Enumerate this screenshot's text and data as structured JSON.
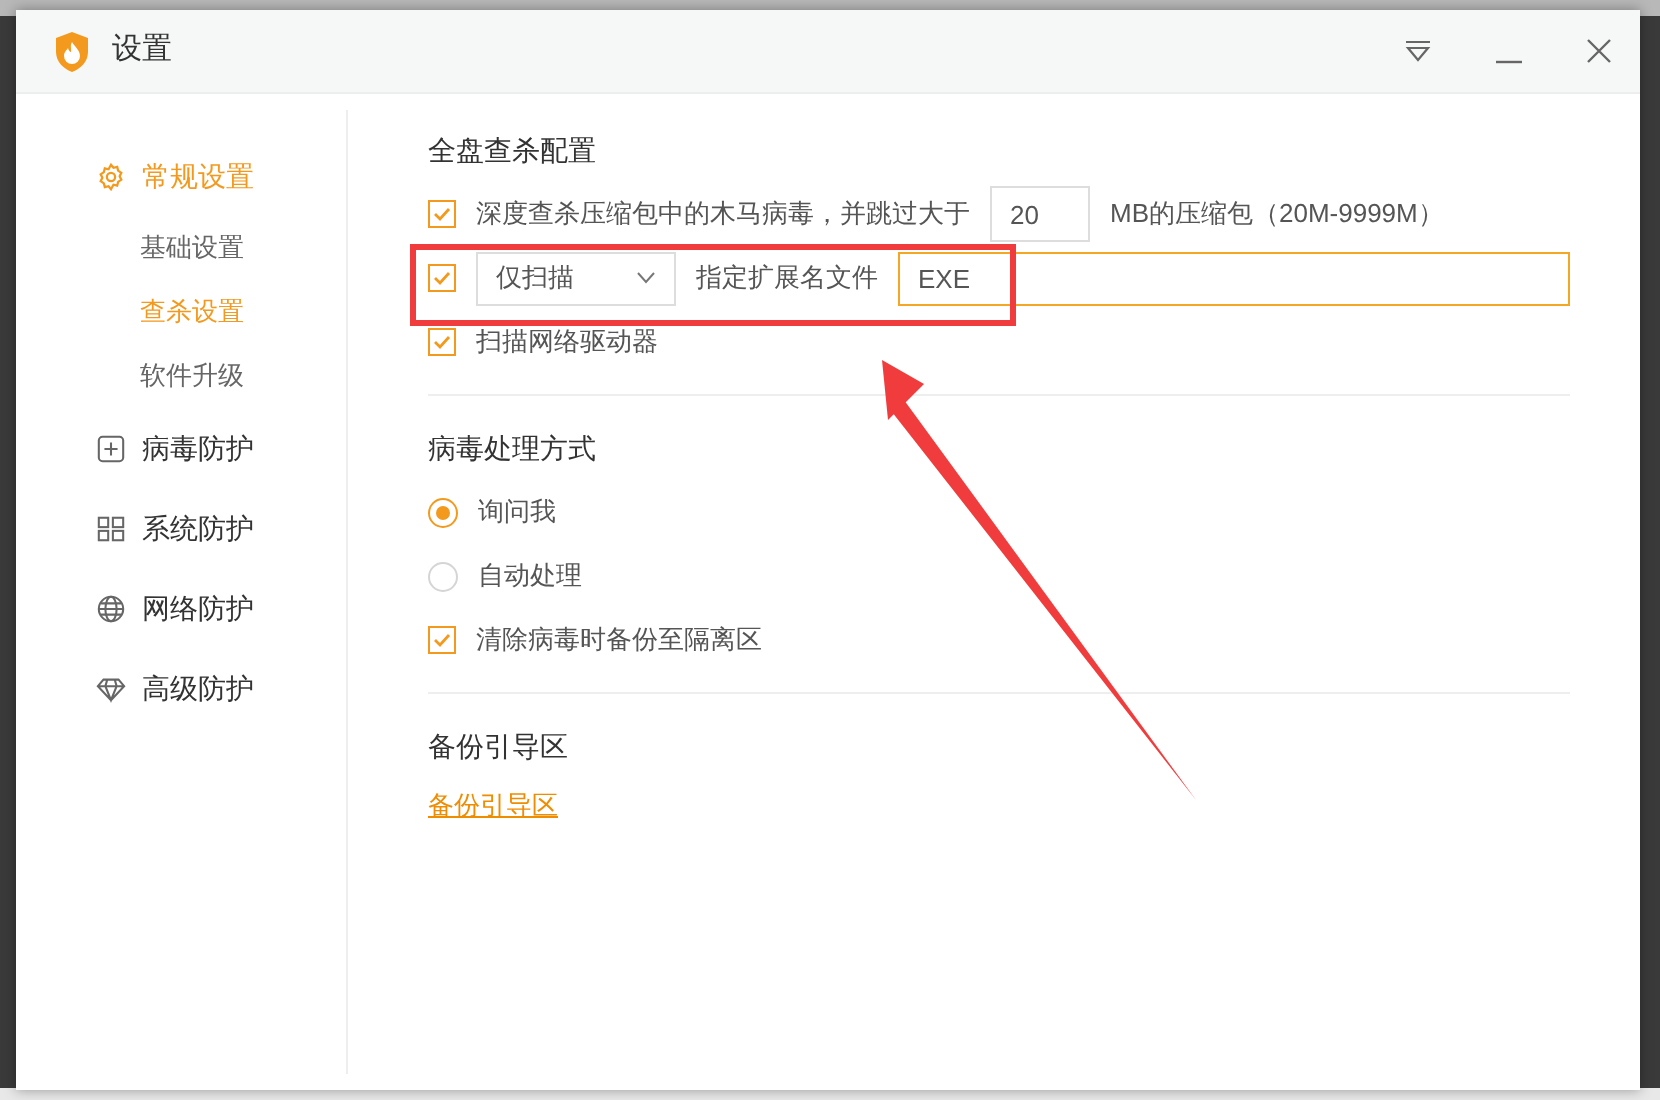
{
  "window": {
    "title": "设置"
  },
  "sidebar": {
    "items": [
      {
        "label": "常规设置",
        "selected": true,
        "children": [
          {
            "label": "基础设置",
            "selected": false
          },
          {
            "label": "查杀设置",
            "selected": true
          },
          {
            "label": "软件升级",
            "selected": false
          }
        ]
      },
      {
        "label": "病毒防护",
        "selected": false
      },
      {
        "label": "系统防护",
        "selected": false
      },
      {
        "label": "网络防护",
        "selected": false
      },
      {
        "label": "高级防护",
        "selected": false
      }
    ]
  },
  "sections": [
    {
      "title": "全盘查杀配置",
      "rows": [
        {
          "kind": "archive",
          "checked": true,
          "label": "深度查杀压缩包中的木马病毒，并跳过大于",
          "value": "20",
          "suffix": "MB的压缩包（20M-9999M）"
        },
        {
          "kind": "extension",
          "checked": true,
          "dropdown": "仅扫描",
          "label": "指定扩展名文件",
          "value": "EXE"
        },
        {
          "kind": "checkbox",
          "checked": true,
          "label": "扫描网络驱动器"
        }
      ]
    },
    {
      "title": "病毒处理方式",
      "rows": [
        {
          "kind": "radio",
          "selected": true,
          "label": "询问我"
        },
        {
          "kind": "radio",
          "selected": false,
          "label": "自动处理"
        },
        {
          "kind": "checkbox",
          "checked": true,
          "label": "清除病毒时备份至隔离区"
        }
      ]
    },
    {
      "title": "备份引导区",
      "rows": [
        {
          "kind": "link",
          "label": "备份引导区"
        }
      ]
    }
  ]
}
